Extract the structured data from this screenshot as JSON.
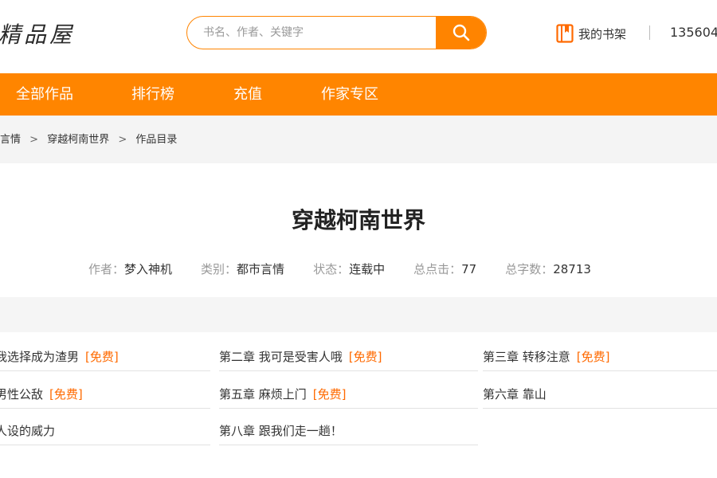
{
  "header": {
    "logo_text": "精品屋",
    "search": {
      "placeholder": "书名、作者、关键字",
      "value": ""
    },
    "shelf_label": "我的书架",
    "user_text": "135604"
  },
  "nav": {
    "items": [
      {
        "label": "全部作品"
      },
      {
        "label": "排行榜"
      },
      {
        "label": "充值"
      },
      {
        "label": "作家专区"
      }
    ]
  },
  "breadcrumb": {
    "items": [
      "言情",
      "穿越柯南世界",
      "作品目录"
    ],
    "separator": ">"
  },
  "book": {
    "title": "穿越柯南世界",
    "meta": [
      {
        "key": "作者：",
        "value": "梦入神机"
      },
      {
        "key": "类别：",
        "value": "都市言情"
      },
      {
        "key": "状态：",
        "value": "连载中"
      },
      {
        "key": "总点击：",
        "value": "77"
      },
      {
        "key": "总字数：",
        "value": "28713"
      }
    ]
  },
  "chapters": [
    {
      "title": "我选择成为渣男",
      "badge": "[免费]"
    },
    {
      "title": "第二章 我可是受害人哦",
      "badge": "[免费]"
    },
    {
      "title": "第三章 转移注意",
      "badge": "[免费]"
    },
    {
      "title": "男性公敌",
      "badge": "[免费]"
    },
    {
      "title": "第五章 麻烦上门",
      "badge": "[免费]"
    },
    {
      "title": "第六章 靠山",
      "badge": ""
    },
    {
      "title": "人设的威力",
      "badge": ""
    },
    {
      "title": "第八章 跟我们走一趟！",
      "badge": ""
    }
  ],
  "colors": {
    "accent": "#ff8500",
    "free_badge": "#ff6a00",
    "band": "#f4f4f4"
  }
}
